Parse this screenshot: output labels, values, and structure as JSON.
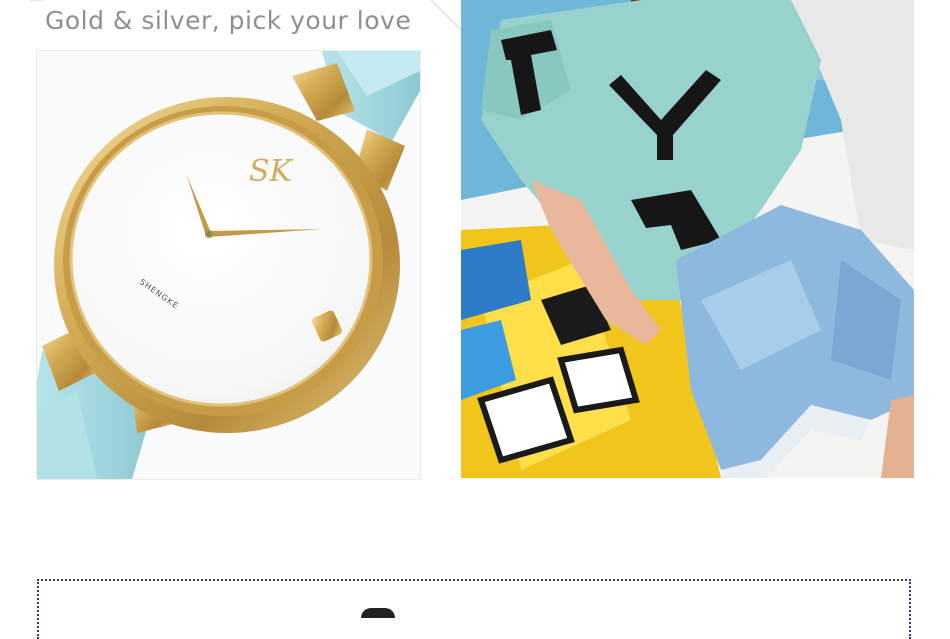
{
  "headline": "Gold & silver, pick your love",
  "watch": {
    "logo_text": "SK",
    "brand_text": "SHENGKE"
  },
  "colors": {
    "gold": "#c9a24a",
    "strap": "#a7dbe2",
    "headline": "#8f8f8f",
    "frame_border": "#33338a"
  }
}
